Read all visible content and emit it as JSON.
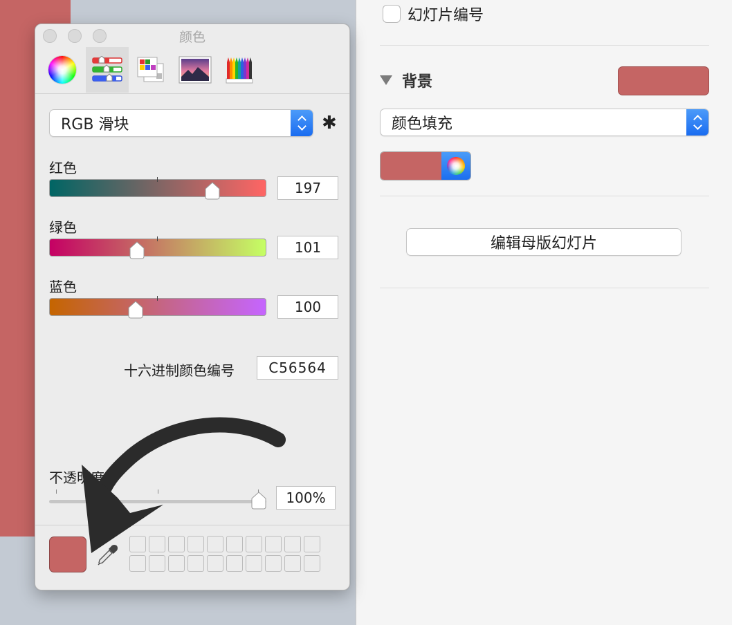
{
  "inspector": {
    "slide_number_label": "幻灯片编号",
    "background_section_title": "背景",
    "fill_type_value": "颜色填充",
    "edit_master_label": "编辑母版幻灯片",
    "background_color": "#c56564"
  },
  "colors_panel": {
    "title": "颜色",
    "mode_tabs": [
      {
        "name": "color-wheel",
        "icon": "color-wheel-icon",
        "active": false
      },
      {
        "name": "color-sliders",
        "icon": "sliders-icon",
        "active": true
      },
      {
        "name": "color-palettes",
        "icon": "palettes-icon",
        "active": false
      },
      {
        "name": "image-palettes",
        "icon": "image-palette-icon",
        "active": false
      },
      {
        "name": "pencils",
        "icon": "pencils-icon",
        "active": false
      }
    ],
    "slider_mode_value": "RGB 滑块",
    "red_label": "红色",
    "red_value": "197",
    "green_label": "绿色",
    "green_value": "101",
    "blue_label": "蓝色",
    "blue_value": "100",
    "hex_label": "十六进制颜色编号",
    "hex_value": "C56564",
    "opacity_label": "不透明度",
    "opacity_value": "100%",
    "current_color": "#c56564"
  },
  "colors": {
    "accent_blue": "#1a6cf0",
    "selected_color": "#c56564"
  }
}
